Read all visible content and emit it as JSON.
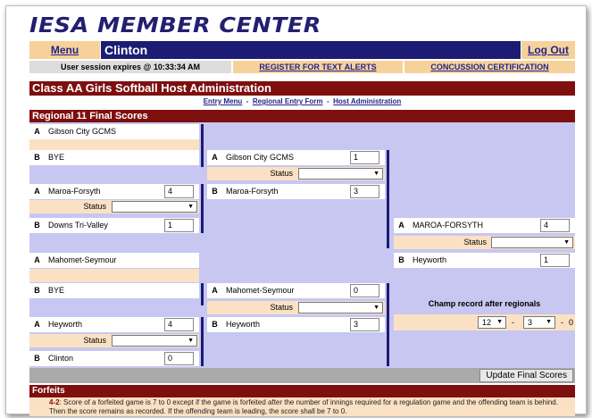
{
  "header": {
    "logo": "IESA MEMBER CENTER",
    "menu_label": "Menu",
    "city": "Clinton",
    "logout_label": "Log Out"
  },
  "infobar": {
    "session": "User session expires @ 10:33:34 AM",
    "alerts": "REGISTER FOR TEXT ALERTS",
    "concussion": "CONCUSSION CERTIFICATION"
  },
  "main": {
    "title": "Class AA Girls Softball Host Administration",
    "links": {
      "entry_menu": "Entry Menu",
      "sep": "-",
      "regional_form": "Regional Entry Form",
      "host_admin": "Host Administration"
    },
    "section": "Regional 11 Final Scores"
  },
  "bracket": {
    "round1": [
      {
        "slot": "A",
        "team": "Gibson City GCMS",
        "score": ""
      },
      {
        "slot": "B",
        "team": "BYE",
        "score": ""
      },
      {
        "slot": "A",
        "team": "Maroa-Forsyth",
        "score": "4"
      },
      {
        "slot": "B",
        "team": "Downs Tri-Valley",
        "score": "1"
      },
      {
        "slot": "A",
        "team": "Mahomet-Seymour",
        "score": ""
      },
      {
        "slot": "B",
        "team": "BYE",
        "score": ""
      },
      {
        "slot": "A",
        "team": "Heyworth",
        "score": "4"
      },
      {
        "slot": "B",
        "team": "Clinton",
        "score": "0"
      }
    ],
    "round2": [
      {
        "slot": "A",
        "team": "Gibson City GCMS",
        "score": "1"
      },
      {
        "slot": "B",
        "team": "Maroa-Forsyth",
        "score": "3"
      },
      {
        "slot": "A",
        "team": "Mahomet-Seymour",
        "score": "0"
      },
      {
        "slot": "B",
        "team": "Heyworth",
        "score": "3"
      }
    ],
    "round3": [
      {
        "slot": "A",
        "team": "MAROA-FORSYTH",
        "score": "4"
      },
      {
        "slot": "B",
        "team": "Heyworth",
        "score": "1"
      }
    ],
    "status_label": "Status",
    "champ_label": "Champ record after regionals",
    "champ_wins": "12",
    "champ_losses": "3",
    "champ_dash": "-",
    "champ_ties": "0",
    "dropdown_arrow": "▼"
  },
  "update_label": "Update Final Scores",
  "forfeits": {
    "title": "Forfeits",
    "rule_id": "4-2",
    "rule_text": ": Score of a forfeited game is 7 to 0 except if the game is forfeited after the number of innings required for a regulation game and the offending team is behind. Then the score remains as recorded. If the offending team is leading, the score shall be 7 to 0."
  },
  "colors": {
    "navy": "#1c1c75",
    "maroon": "#7e0f0f",
    "peach": "#fbe1c4",
    "lavender": "#c7c7f1"
  }
}
